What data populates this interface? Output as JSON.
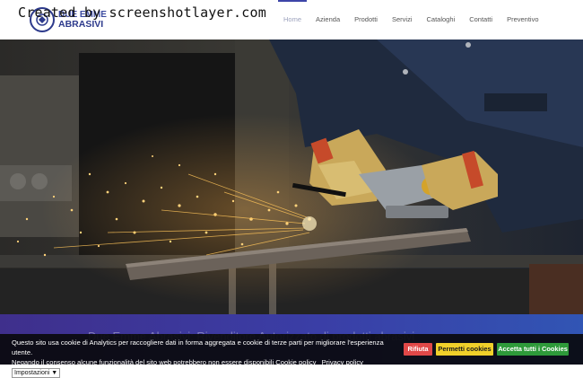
{
  "watermark": "Created by screenshotlayer.com",
  "brand": {
    "line1": "DUE EMME",
    "line2": "ABRASIVI"
  },
  "nav": {
    "items": [
      {
        "label": "Home",
        "active": true
      },
      {
        "label": "Azienda"
      },
      {
        "label": "Prodotti"
      },
      {
        "label": "Servizi"
      },
      {
        "label": "Cataloghi"
      },
      {
        "label": "Contatti"
      },
      {
        "label": "Preventivo"
      }
    ]
  },
  "hero": {
    "image": "worker-using-angle-grinder-with-sparks"
  },
  "band": {
    "text": "Due Emme Abrasivi: Rivenditore Autorizzato di prodotti abrasivi"
  },
  "cookie": {
    "text_line1": "Questo sito usa cookie di Analytics per raccogliere dati in forma aggregata e cookie di terze parti per migliorare l'esperienza utente.",
    "text_line2": "Negando il consenso alcune funzionalità del sito web potrebbero non essere disponibili",
    "cookie_policy": "Cookie policy",
    "privacy_policy": "Privacy policy",
    "settings": "Impostazioni",
    "refuse": "Rifiuta",
    "allow": "Permetti cookies",
    "accept_all": "Accetta tutti i Cookies"
  }
}
